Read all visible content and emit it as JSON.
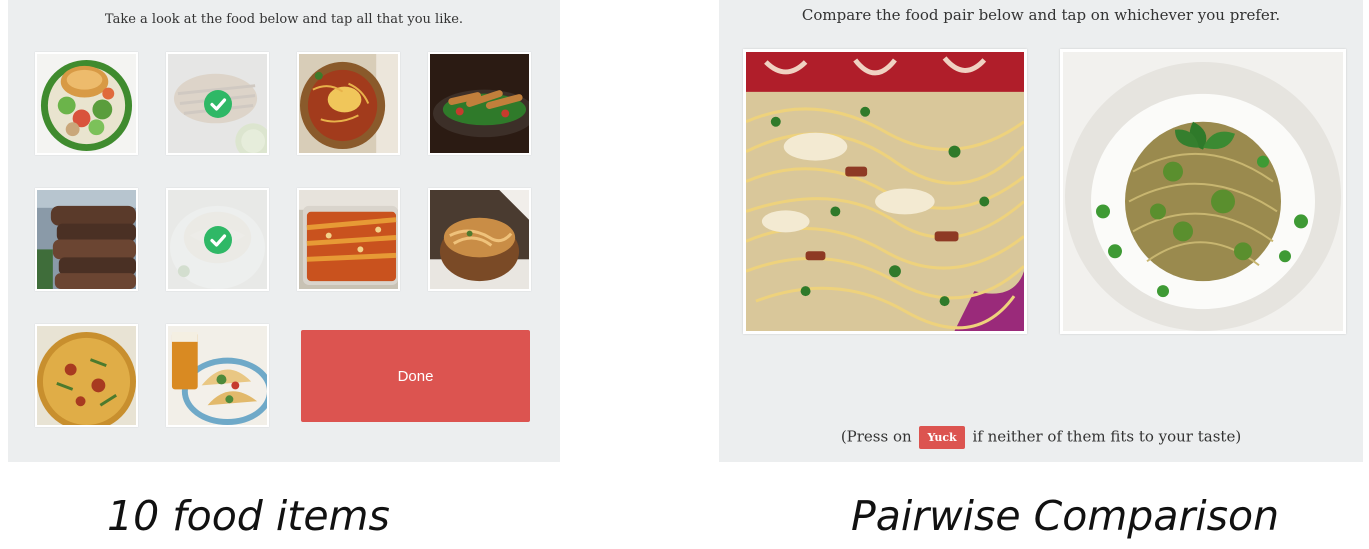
{
  "left_panel": {
    "instruction": "Take a look at the food below and tap all that you like.",
    "tiles": [
      {
        "name": "sandwich-salad-bowl",
        "selected": false
      },
      {
        "name": "grilled-chicken-lime",
        "selected": true
      },
      {
        "name": "chili-soup-bowl",
        "selected": false
      },
      {
        "name": "chicken-salad-plate",
        "selected": false
      },
      {
        "name": "stacked-burgers",
        "selected": false
      },
      {
        "name": "mashed-potatoes",
        "selected": true
      },
      {
        "name": "baked-casserole",
        "selected": false
      },
      {
        "name": "noodles-bowl",
        "selected": false
      },
      {
        "name": "frittata",
        "selected": false
      },
      {
        "name": "tacos-and-beer",
        "selected": false
      }
    ],
    "done_label": "Done"
  },
  "right_panel": {
    "instruction": "Compare the food pair below and tap on whichever you prefer.",
    "option_a": "spaghetti-carbonara",
    "option_b": "pesto-pasta-peas",
    "footer_before": "(Press on",
    "yuck_label": "Yuck",
    "footer_after": "if neither of them fits to your taste)"
  },
  "captions": {
    "left": "10 food items",
    "right": "Pairwise Comparison"
  },
  "colors": {
    "panel_bg": "#eceeef",
    "accent_red": "#dc5450",
    "check_green": "#2fb866"
  },
  "icons": {
    "check": "check-circle-icon"
  }
}
